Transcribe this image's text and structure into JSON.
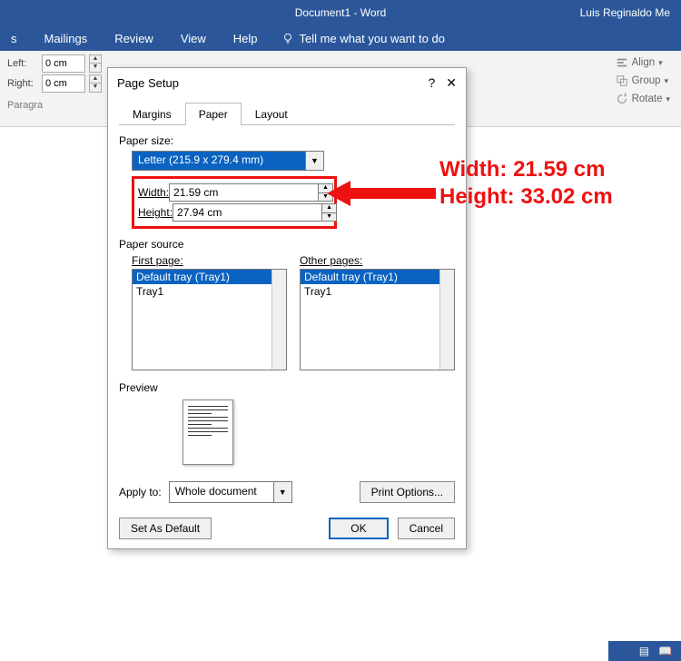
{
  "app": {
    "title": "Document1  -  Word",
    "user": "Luis Reginaldo Me"
  },
  "ribbon": {
    "tabs": [
      "s",
      "Mailings",
      "Review",
      "View",
      "Help"
    ],
    "tell": "Tell me what you want to do",
    "indent": {
      "left_label": "Left:",
      "right_label": "Right:",
      "left_value": "0 cm",
      "right_value": "0 cm",
      "group_caption": "Paragra"
    },
    "arrange": {
      "align": "Align",
      "group": "Group",
      "rotate": "Rotate"
    }
  },
  "dialog": {
    "title": "Page Setup",
    "help": "?",
    "close": "✕",
    "tabs": {
      "margins": "Margins",
      "paper": "Paper",
      "layout": "Layout"
    },
    "paper_size_label": "Paper size:",
    "paper_size_value": "Letter (215.9 x 279.4 mm)",
    "width_label": "Width:",
    "width_value": "21.59 cm",
    "height_label": "Height:",
    "height_value": "27.94 cm",
    "paper_source_label": "Paper source",
    "first_page_label": "First page:",
    "other_pages_label": "Other pages:",
    "tray_default": "Default tray (Tray1)",
    "tray1": "Tray1",
    "preview_label": "Preview",
    "apply_to_label": "Apply to:",
    "apply_to_value": "Whole document",
    "print_options": "Print Options...",
    "set_default": "Set As Default",
    "ok": "OK",
    "cancel": "Cancel"
  },
  "annotation": {
    "line1": "Width: 21.59 cm",
    "line2": "Height: 33.02 cm"
  }
}
